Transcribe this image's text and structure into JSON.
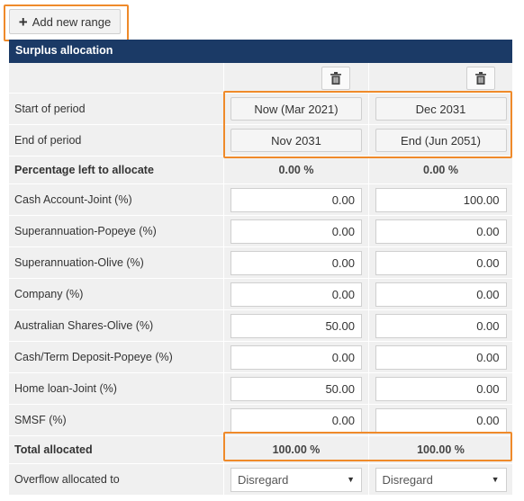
{
  "toolbar": {
    "add_range_label": "Add new range"
  },
  "section": {
    "title": "Surplus allocation"
  },
  "labels": {
    "start": "Start of period",
    "end": "End of period",
    "pct_left": "Percentage left to allocate",
    "total": "Total allocated",
    "overflow": "Overflow allocated to"
  },
  "ranges": [
    {
      "start": "Now (Mar 2021)",
      "end": "Nov 2031",
      "pct_left": "0.00 %",
      "total": "100.00 %",
      "overflow": "Disregard"
    },
    {
      "start": "Dec 2031",
      "end": "End (Jun 2051)",
      "pct_left": "0.00 %",
      "total": "100.00 %",
      "overflow": "Disregard"
    }
  ],
  "accounts": [
    {
      "name": "Cash Account-Joint (%)",
      "values": [
        "0.00",
        "100.00"
      ]
    },
    {
      "name": "Superannuation-Popeye (%)",
      "values": [
        "0.00",
        "0.00"
      ]
    },
    {
      "name": "Superannuation-Olive (%)",
      "values": [
        "0.00",
        "0.00"
      ]
    },
    {
      "name": "Company (%)",
      "values": [
        "0.00",
        "0.00"
      ]
    },
    {
      "name": "Australian Shares-Olive (%)",
      "values": [
        "50.00",
        "0.00"
      ]
    },
    {
      "name": "Cash/Term Deposit-Popeye (%)",
      "values": [
        "0.00",
        "0.00"
      ]
    },
    {
      "name": "Home loan-Joint (%)",
      "values": [
        "50.00",
        "0.00"
      ]
    },
    {
      "name": "SMSF (%)",
      "values": [
        "0.00",
        "0.00"
      ]
    }
  ],
  "icons": {
    "add": "plus-icon",
    "delete": "trash-icon",
    "dropdown": "caret-down-icon"
  },
  "colors": {
    "header": "#1b3a66",
    "highlight": "#ef8a2a",
    "cell": "#f0f0f0"
  }
}
